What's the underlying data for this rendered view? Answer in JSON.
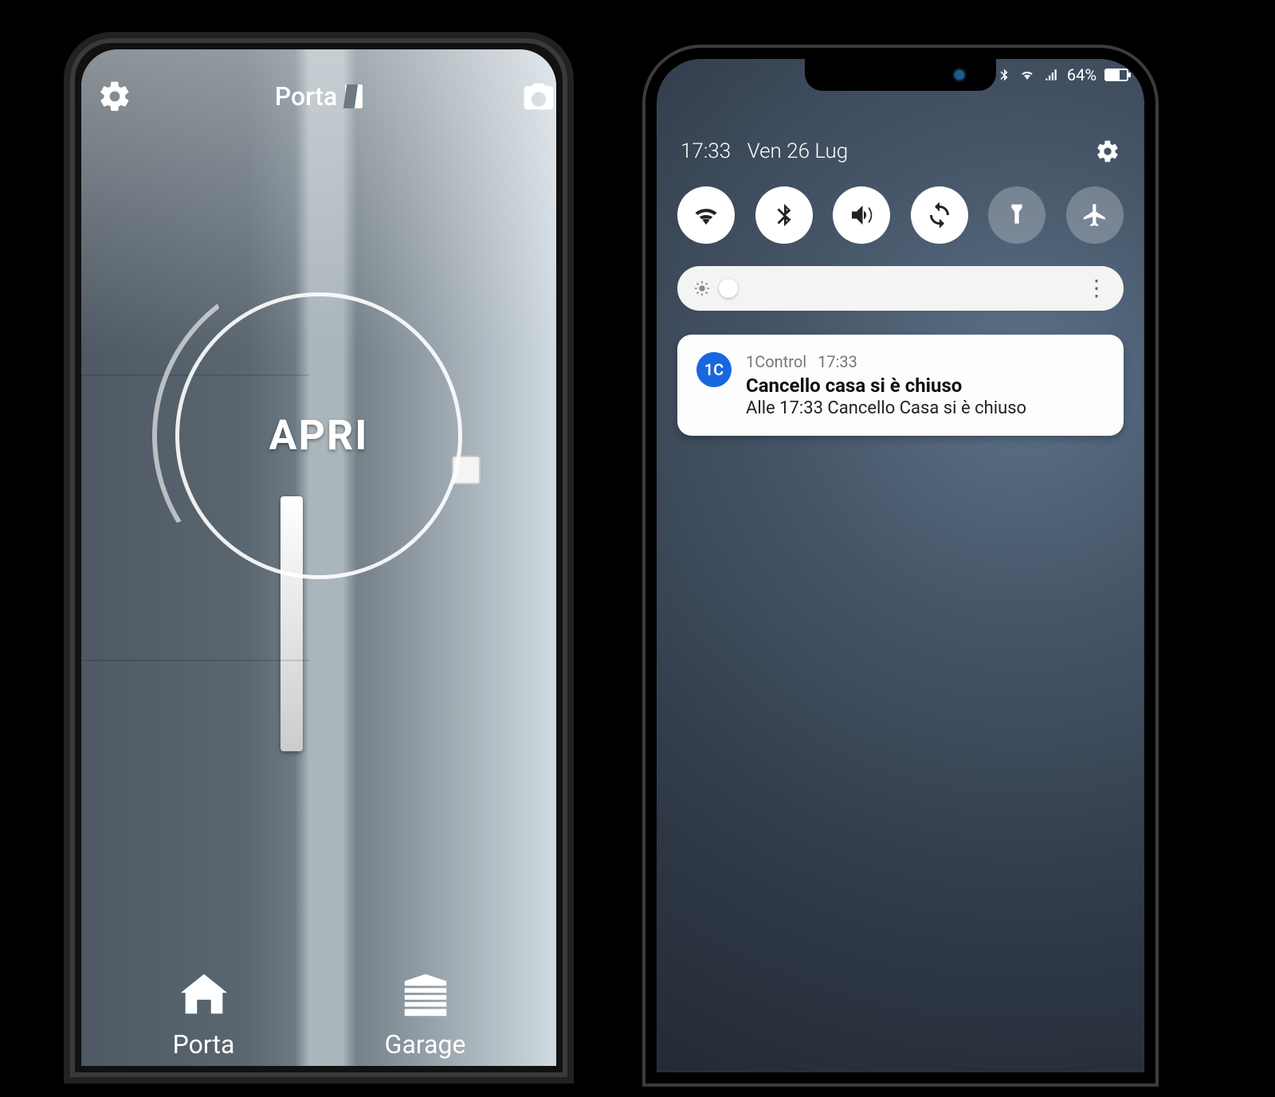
{
  "left": {
    "header_title": "Porta",
    "main_action": "APRI",
    "tabs": [
      {
        "label": "Porta"
      },
      {
        "label": "Garage"
      }
    ]
  },
  "right": {
    "status": {
      "battery_pct": "64%"
    },
    "clock": {
      "time": "17:33",
      "date": "Ven 26 Lug"
    },
    "quick_settings": [
      {
        "name": "wifi",
        "on": true
      },
      {
        "name": "bluetooth",
        "on": true
      },
      {
        "name": "sound",
        "on": true
      },
      {
        "name": "autorotate",
        "on": true
      },
      {
        "name": "flashlight",
        "on": false
      },
      {
        "name": "airplane",
        "on": false
      }
    ],
    "notification": {
      "app": "1Control",
      "time": "17:33",
      "title": "Cancello casa si è chiuso",
      "body": "Alle 17:33 Cancello Casa si è chiuso",
      "icon_text": "1C"
    }
  }
}
